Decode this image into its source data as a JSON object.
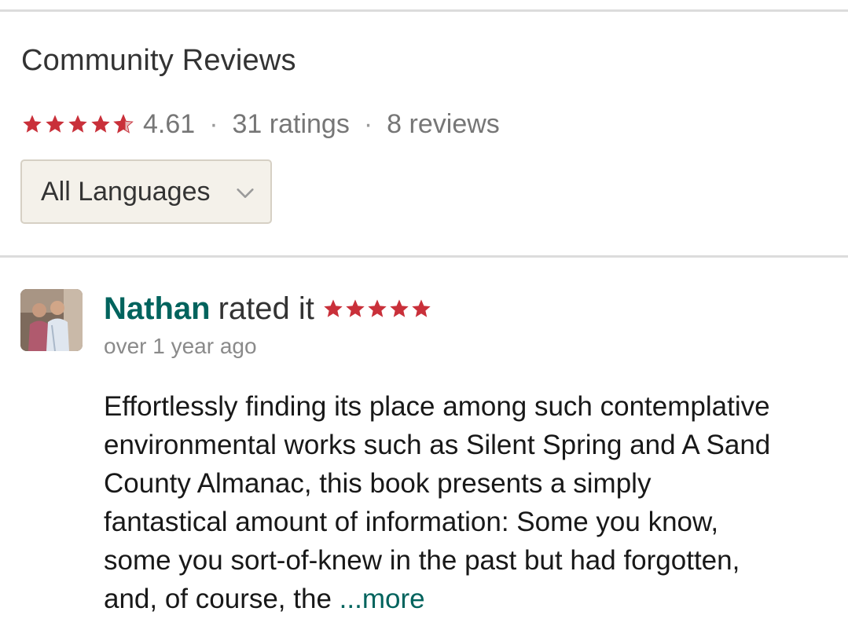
{
  "section": {
    "title": "Community Reviews"
  },
  "summary": {
    "average_rating": "4.61",
    "ratings": "31 ratings",
    "reviews": "8 reviews",
    "separator": "·",
    "stars_filled": 4.61,
    "star_color": "#c9303a"
  },
  "language_filter": {
    "selected": "All Languages"
  },
  "review": {
    "reviewer": "Nathan",
    "rated_text": "rated it",
    "stars": 5,
    "date": "over 1 year ago",
    "body_lines": [
      "Effortlessly finding its place among such contemplative",
      "environmental works such as Silent Spring and A Sand",
      "County Almanac, this book presents a simply",
      "fantastical amount of information: Some you know,",
      "some you sort-of-knew in the past but had forgotten,",
      "and, of course, the"
    ],
    "more_label": "...more"
  },
  "colors": {
    "accent": "#00635d",
    "star": "#c9303a",
    "select_bg": "#f4f1ea",
    "divider": "#dcdcdc"
  },
  "icons": {
    "star": "star-icon",
    "dropdown": "chevron-down-icon",
    "avatar": "avatar"
  }
}
